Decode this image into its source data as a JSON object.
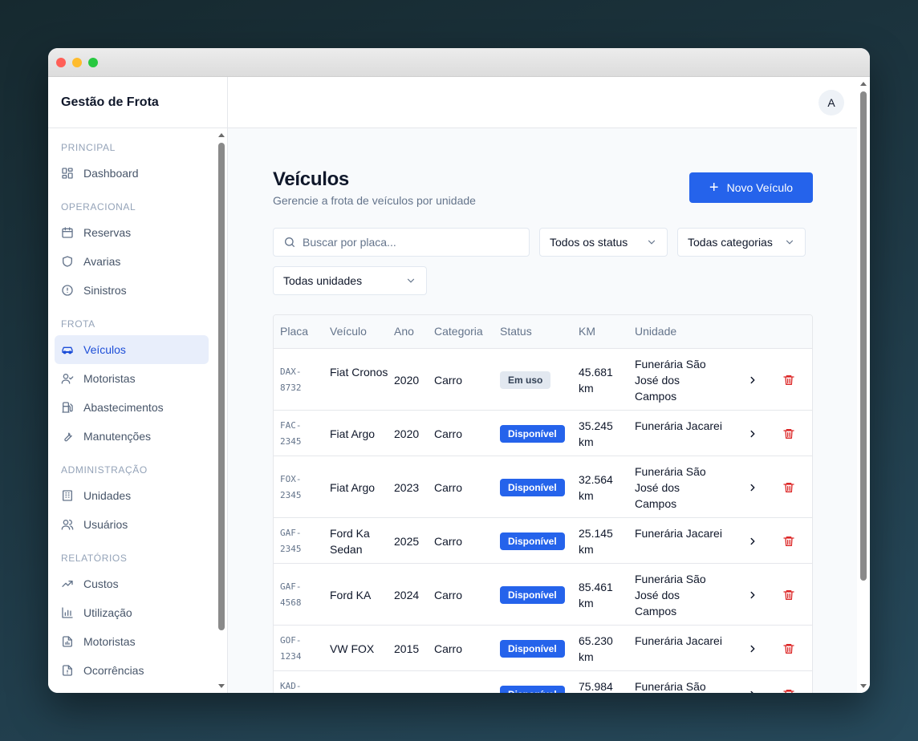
{
  "app": {
    "brand": "Gestão de Frota",
    "avatar": "A"
  },
  "sidebar": {
    "sections": [
      {
        "title": "PRINCIPAL",
        "items": [
          {
            "label": "Dashboard",
            "icon": "dashboard-icon"
          }
        ]
      },
      {
        "title": "OPERACIONAL",
        "items": [
          {
            "label": "Reservas",
            "icon": "calendar-icon"
          },
          {
            "label": "Avarias",
            "icon": "shield-icon"
          },
          {
            "label": "Sinistros",
            "icon": "alert-circle-icon"
          }
        ]
      },
      {
        "title": "FROTA",
        "items": [
          {
            "label": "Veículos",
            "icon": "car-icon",
            "active": true
          },
          {
            "label": "Motoristas",
            "icon": "user-check-icon"
          },
          {
            "label": "Abastecimentos",
            "icon": "fuel-icon"
          },
          {
            "label": "Manutenções",
            "icon": "wrench-icon"
          }
        ]
      },
      {
        "title": "ADMINISTRAÇÃO",
        "items": [
          {
            "label": "Unidades",
            "icon": "building-icon"
          },
          {
            "label": "Usuários",
            "icon": "users-icon"
          }
        ]
      },
      {
        "title": "RELATÓRIOS",
        "items": [
          {
            "label": "Custos",
            "icon": "trending-up-icon"
          },
          {
            "label": "Utilização",
            "icon": "bar-chart-icon"
          },
          {
            "label": "Motoristas",
            "icon": "file-chart-icon"
          },
          {
            "label": "Ocorrências",
            "icon": "file-alert-icon"
          }
        ]
      }
    ]
  },
  "page": {
    "title": "Veículos",
    "subtitle": "Gerencie a frota de veículos por unidade",
    "new_button": "Novo Veículo",
    "search_placeholder": "Buscar por placa...",
    "filters": {
      "status": "Todos os status",
      "category": "Todas categorias",
      "unit": "Todas unidades"
    }
  },
  "table": {
    "columns": [
      "Placa",
      "Veículo",
      "Ano",
      "Categoria",
      "Status",
      "KM",
      "Unidade"
    ],
    "rows": [
      {
        "plate": "DAX-8732",
        "vehicle": "Fiat Cronos",
        "year": "2020",
        "category": "Carro",
        "status": "Em uso",
        "km": "45.681 km",
        "unit": "Funerária São José dos Campos"
      },
      {
        "plate": "FAC-2345",
        "vehicle": "Fiat Argo",
        "year": "2020",
        "category": "Carro",
        "status": "Disponível",
        "km": "35.245 km",
        "unit": "Funerária Jacarei"
      },
      {
        "plate": "FOX-2345",
        "vehicle": "Fiat Argo",
        "year": "2023",
        "category": "Carro",
        "status": "Disponível",
        "km": "32.564 km",
        "unit": "Funerária São José dos Campos"
      },
      {
        "plate": "GAF-2345",
        "vehicle": "Ford Ka Sedan",
        "year": "2025",
        "category": "Carro",
        "status": "Disponível",
        "km": "25.145 km",
        "unit": "Funerária Jacarei"
      },
      {
        "plate": "GAF-4568",
        "vehicle": "Ford KA",
        "year": "2024",
        "category": "Carro",
        "status": "Disponível",
        "km": "85.461 km",
        "unit": "Funerária São José dos Campos"
      },
      {
        "plate": "GOF-1234",
        "vehicle": "VW FOX",
        "year": "2015",
        "category": "Carro",
        "status": "Disponível",
        "km": "65.230 km",
        "unit": "Funerária Jacarei"
      },
      {
        "plate": "KAD-",
        "vehicle": "",
        "year": "",
        "category": "",
        "status": "Disponível",
        "km": "75.984",
        "unit": "Funerária São"
      }
    ]
  },
  "colors": {
    "accent": "#2563eb",
    "danger": "#dc2626",
    "active_bg": "#e8eefb"
  }
}
